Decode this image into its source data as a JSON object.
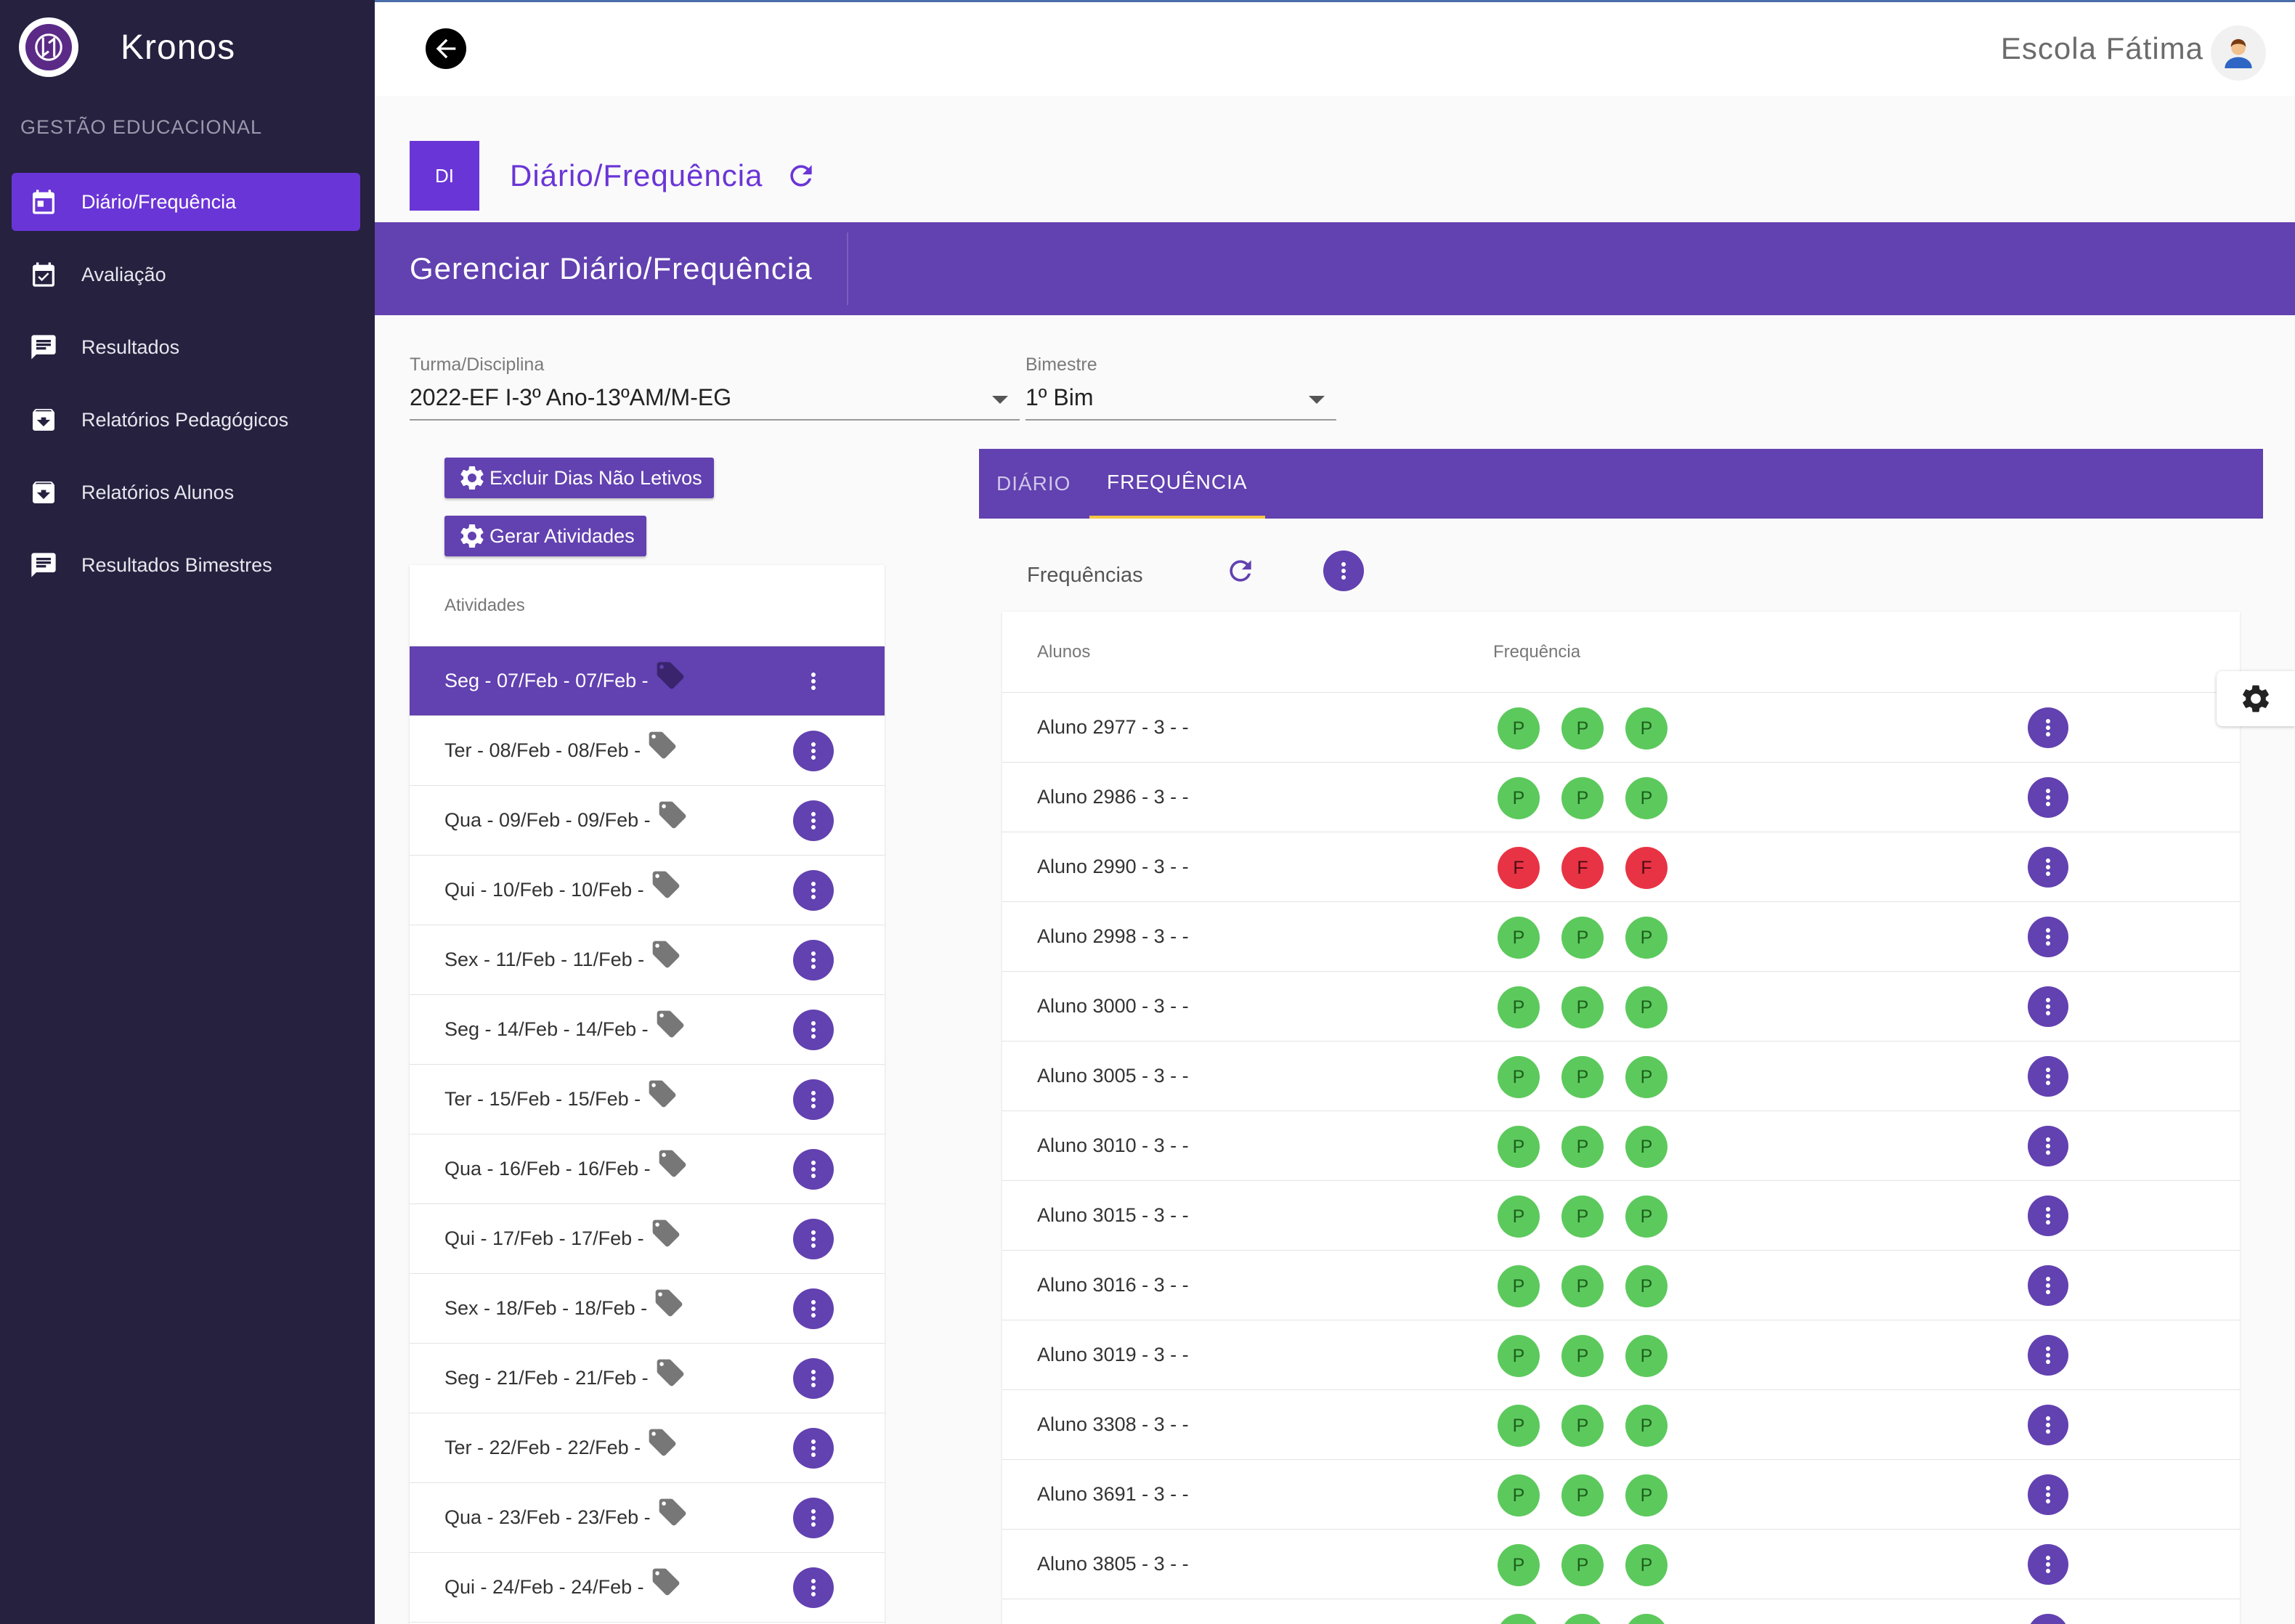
{
  "app": {
    "name": "Kronos",
    "section": "GESTÃO EDUCACIONAL"
  },
  "sidebar": {
    "items": [
      {
        "label": "Diário/Frequência",
        "icon": "calendar-icon",
        "active": true
      },
      {
        "label": "Avaliação",
        "icon": "calendar-check-icon",
        "active": false
      },
      {
        "label": "Resultados",
        "icon": "chat-list-icon",
        "active": false
      },
      {
        "label": "Relatórios Pedagógicos",
        "icon": "archive-icon",
        "active": false
      },
      {
        "label": "Relatórios Alunos",
        "icon": "archive-icon",
        "active": false
      },
      {
        "label": "Resultados Bimestres",
        "icon": "chat-list-icon",
        "active": false
      }
    ]
  },
  "topbar": {
    "school": "Escola Fátima",
    "back_icon": "arrow-left-icon",
    "avatar_icon": "user-avatar-icon"
  },
  "page": {
    "badge": "DI",
    "title": "Diário/Frequência",
    "banner_title": "Gerenciar Diário/Frequência"
  },
  "filters": {
    "turma": {
      "label": "Turma/Disciplina",
      "value": "2022-EF I-3º Ano-13ºAM/M-EG"
    },
    "bimestre": {
      "label": "Bimestre",
      "value": "1º Bim"
    }
  },
  "actions": {
    "excluir": "Excluir Dias Não Letivos",
    "gerar": "Gerar Atividades"
  },
  "activities": {
    "header": "Atividades",
    "items": [
      "Seg - 07/Feb - 07/Feb -",
      "Ter - 08/Feb - 08/Feb -",
      "Qua - 09/Feb - 09/Feb -",
      "Qui - 10/Feb - 10/Feb -",
      "Sex - 11/Feb - 11/Feb -",
      "Seg - 14/Feb - 14/Feb -",
      "Ter - 15/Feb - 15/Feb -",
      "Qua - 16/Feb - 16/Feb -",
      "Qui - 17/Feb - 17/Feb -",
      "Sex - 18/Feb - 18/Feb -",
      "Seg - 21/Feb - 21/Feb -",
      "Ter - 22/Feb - 22/Feb -",
      "Qua - 23/Feb - 23/Feb -",
      "Qui - 24/Feb - 24/Feb -"
    ],
    "selected_index": 0
  },
  "tabs": [
    {
      "label": "DIÁRIO",
      "active": false
    },
    {
      "label": "FREQUÊNCIA",
      "active": true
    }
  ],
  "frequencias": {
    "label": "Frequências",
    "columns": {
      "alunos": "Alunos",
      "frequencia": "Frequência"
    },
    "rows": [
      {
        "name": "Aluno 2977 - 3 - -",
        "marks": [
          "P",
          "P",
          "P"
        ]
      },
      {
        "name": "Aluno 2986 - 3 - -",
        "marks": [
          "P",
          "P",
          "P"
        ]
      },
      {
        "name": "Aluno 2990 - 3 - -",
        "marks": [
          "F",
          "F",
          "F"
        ]
      },
      {
        "name": "Aluno 2998 - 3 - -",
        "marks": [
          "P",
          "P",
          "P"
        ]
      },
      {
        "name": "Aluno 3000 - 3 - -",
        "marks": [
          "P",
          "P",
          "P"
        ]
      },
      {
        "name": "Aluno 3005 - 3 - -",
        "marks": [
          "P",
          "P",
          "P"
        ]
      },
      {
        "name": "Aluno 3010 - 3 - -",
        "marks": [
          "P",
          "P",
          "P"
        ]
      },
      {
        "name": "Aluno 3015 - 3 - -",
        "marks": [
          "P",
          "P",
          "P"
        ]
      },
      {
        "name": "Aluno 3016 - 3 - -",
        "marks": [
          "P",
          "P",
          "P"
        ]
      },
      {
        "name": "Aluno 3019 - 3 - -",
        "marks": [
          "P",
          "P",
          "P"
        ]
      },
      {
        "name": "Aluno 3308 - 3 - -",
        "marks": [
          "P",
          "P",
          "P"
        ]
      },
      {
        "name": "Aluno 3691 - 3 - -",
        "marks": [
          "P",
          "P",
          "P"
        ]
      },
      {
        "name": "Aluno 3805 - 3 - -",
        "marks": [
          "P",
          "P",
          "P"
        ]
      },
      {
        "name": "",
        "marks": [
          "P",
          "P",
          "P"
        ]
      }
    ]
  },
  "colors": {
    "sidebar": "#25213f",
    "accent": "#6241b0",
    "active": "#6a35d6",
    "present": "#5cc95c",
    "absent": "#e83344"
  }
}
